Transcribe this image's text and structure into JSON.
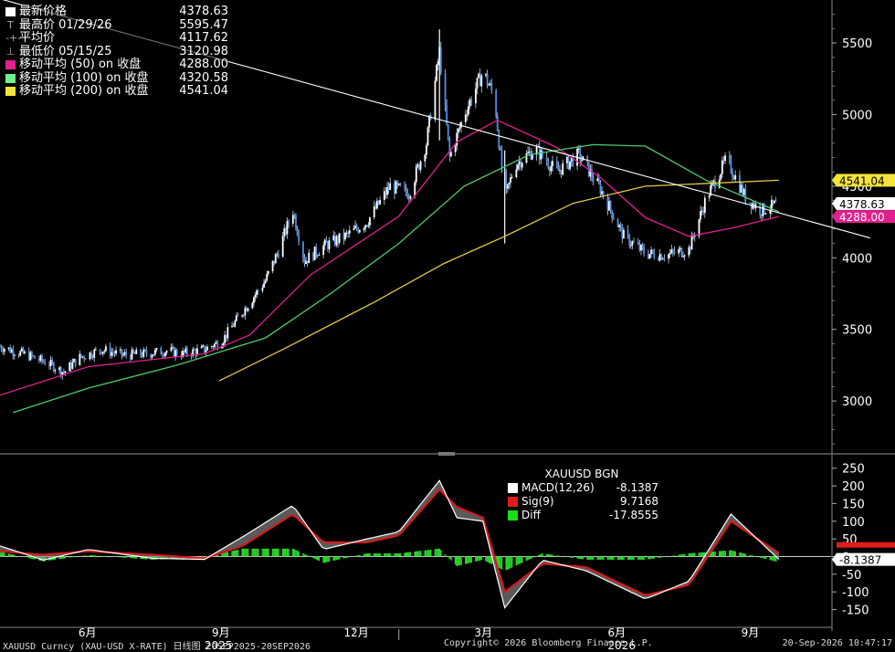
{
  "chart_data": [
    {
      "type": "candlestick",
      "instrument": "XAUUSD Curncy (XAU-USD X-RATE)",
      "ylim": [
        2650,
        5800
      ],
      "y_ticks": [
        3000,
        3500,
        4000,
        4500,
        5000,
        5500
      ],
      "x_ticks": [
        "6月",
        "9月",
        "12月",
        "3月",
        "6月",
        "9月"
      ],
      "year_labels": [
        "2025",
        "2026"
      ],
      "trendline": {
        "from": [
          "2025-09-20",
          6100
        ],
        "to": [
          "2026-09-20",
          4330
        ]
      },
      "close_series": [
        [
          "2025-04-01",
          3380
        ],
        [
          "2025-04-20",
          3320
        ],
        [
          "2025-05-05",
          3260
        ],
        [
          "2025-05-15",
          3200
        ],
        [
          "2025-05-25",
          3300
        ],
        [
          "2025-06-10",
          3360
        ],
        [
          "2025-06-25",
          3320
        ],
        [
          "2025-07-10",
          3330
        ],
        [
          "2025-07-25",
          3350
        ],
        [
          "2025-08-05",
          3330
        ],
        [
          "2025-08-20",
          3360
        ],
        [
          "2025-09-01",
          3420
        ],
        [
          "2025-09-15",
          3620
        ],
        [
          "2025-10-01",
          3840
        ],
        [
          "2025-10-10",
          4050
        ],
        [
          "2025-10-20",
          4330
        ],
        [
          "2025-10-28",
          3980
        ],
        [
          "2025-11-10",
          4080
        ],
        [
          "2025-11-25",
          4150
        ],
        [
          "2025-12-10",
          4250
        ],
        [
          "2025-12-26",
          4500
        ],
        [
          "2026-01-08",
          4450
        ],
        [
          "2026-01-20",
          4800
        ],
        [
          "2026-01-29",
          5440
        ],
        [
          "2026-02-05",
          4700
        ],
        [
          "2026-02-15",
          5000
        ],
        [
          "2026-02-28",
          5300
        ],
        [
          "2026-03-08",
          5120
        ],
        [
          "2026-03-15",
          4400
        ],
        [
          "2026-03-22",
          4650
        ],
        [
          "2026-04-05",
          4760
        ],
        [
          "2026-04-20",
          4600
        ],
        [
          "2026-05-05",
          4720
        ],
        [
          "2026-05-20",
          4480
        ],
        [
          "2026-06-05",
          4150
        ],
        [
          "2026-06-20",
          4030
        ],
        [
          "2026-07-05",
          4020
        ],
        [
          "2026-07-20",
          4060
        ],
        [
          "2026-08-01",
          4420
        ],
        [
          "2026-08-15",
          4690
        ],
        [
          "2026-08-28",
          4420
        ],
        [
          "2026-09-08",
          4330
        ],
        [
          "2026-09-20",
          4378.63
        ]
      ],
      "moving_averages": [
        {
          "name": "移动平均 (50) on 收盘",
          "color": "#e0208e",
          "points": [
            [
              "2025-04-01",
              3040
            ],
            [
              "2025-06-01",
              3240
            ],
            [
              "2025-08-20",
              3330
            ],
            [
              "2025-09-20",
              3460
            ],
            [
              "2025-11-01",
              3880
            ],
            [
              "2026-01-01",
              4290
            ],
            [
              "2026-02-10",
              4810
            ],
            [
              "2026-03-10",
              4960
            ],
            [
              "2026-04-20",
              4770
            ],
            [
              "2026-05-20",
              4560
            ],
            [
              "2026-06-20",
              4280
            ],
            [
              "2026-07-20",
              4150
            ],
            [
              "2026-08-20",
              4210
            ],
            [
              "2026-09-20",
              4288.0
            ]
          ]
        },
        {
          "name": "移动平均 (100) on 收盘",
          "color": "#4fc86c",
          "points": [
            [
              "2025-04-10",
              2920
            ],
            [
              "2025-06-01",
              3090
            ],
            [
              "2025-08-01",
              3250
            ],
            [
              "2025-10-01",
              3440
            ],
            [
              "2025-11-15",
              3750
            ],
            [
              "2026-01-01",
              4100
            ],
            [
              "2026-02-15",
              4500
            ],
            [
              "2026-04-01",
              4720
            ],
            [
              "2026-05-15",
              4790
            ],
            [
              "2026-06-20",
              4780
            ],
            [
              "2026-08-01",
              4540
            ],
            [
              "2026-09-20",
              4320.58
            ]
          ]
        },
        {
          "name": "移动平均 (200) on 收盘",
          "color": "#e3cb47",
          "points": [
            [
              "2025-08-30",
              3140
            ],
            [
              "2025-10-15",
              3370
            ],
            [
              "2025-12-15",
              3690
            ],
            [
              "2026-02-01",
              3960
            ],
            [
              "2026-03-15",
              4150
            ],
            [
              "2026-05-01",
              4380
            ],
            [
              "2026-06-20",
              4500
            ],
            [
              "2026-09-20",
              4541.04
            ]
          ]
        }
      ],
      "price_tags": [
        {
          "value": "4541.04",
          "bg": "#f3e33a",
          "fg": "#000",
          "y": 4541.04
        },
        {
          "value": "4378.63",
          "bg": "#ffffff",
          "fg": "#000",
          "y": 4378.63
        },
        {
          "value": "4288.00",
          "bg": "#e0208e",
          "fg": "#fff",
          "y": 4288.0
        }
      ]
    },
    {
      "type": "macd",
      "ylim": [
        -190,
        270
      ],
      "y_ticks": [
        250,
        200,
        150,
        100,
        50,
        0,
        -50,
        -100,
        -150
      ],
      "macd": [
        [
          "2025-04-01",
          30
        ],
        [
          "2025-05-01",
          -10
        ],
        [
          "2025-06-01",
          20
        ],
        [
          "2025-07-15",
          -5
        ],
        [
          "2025-08-20",
          -8
        ],
        [
          "2025-09-15",
          55
        ],
        [
          "2025-10-20",
          145
        ],
        [
          "2025-11-10",
          20
        ],
        [
          "2025-12-10",
          50
        ],
        [
          "2026-01-01",
          70
        ],
        [
          "2026-01-29",
          215
        ],
        [
          "2026-02-10",
          110
        ],
        [
          "2026-02-28",
          100
        ],
        [
          "2026-03-15",
          -145
        ],
        [
          "2026-04-10",
          -10
        ],
        [
          "2026-05-10",
          -40
        ],
        [
          "2026-06-20",
          -120
        ],
        [
          "2026-07-20",
          -70
        ],
        [
          "2026-08-18",
          120
        ],
        [
          "2026-09-20",
          -8.1387
        ]
      ],
      "signal": [
        [
          "2025-04-01",
          15
        ],
        [
          "2025-05-01",
          5
        ],
        [
          "2025-06-01",
          15
        ],
        [
          "2025-07-15",
          5
        ],
        [
          "2025-08-20",
          -5
        ],
        [
          "2025-09-15",
          30
        ],
        [
          "2025-10-20",
          120
        ],
        [
          "2025-11-10",
          40
        ],
        [
          "2025-12-10",
          40
        ],
        [
          "2026-01-01",
          60
        ],
        [
          "2026-01-29",
          190
        ],
        [
          "2026-02-10",
          140
        ],
        [
          "2026-02-28",
          110
        ],
        [
          "2026-03-15",
          -100
        ],
        [
          "2026-04-10",
          -20
        ],
        [
          "2026-05-10",
          -30
        ],
        [
          "2026-06-20",
          -110
        ],
        [
          "2026-07-20",
          -80
        ],
        [
          "2026-08-18",
          100
        ],
        [
          "2026-09-20",
          9.7168
        ]
      ],
      "series_names": [
        "MACD(12,26)",
        "Sig(9)",
        "Diff"
      ],
      "last_values": [
        "-8.1387",
        "9.7168",
        "-17.8555"
      ],
      "price_tags": [
        {
          "value": "-8.1387",
          "bg": "#ffffff",
          "fg": "#000",
          "y": -8.1387
        }
      ]
    }
  ],
  "legend": {
    "items": [
      {
        "label": "最新价格",
        "value": "4378.63",
        "swatch": "#ffffff",
        "icon": ""
      },
      {
        "label": "最高价 01/29/26",
        "value": "5595.47",
        "swatch": "",
        "icon": "T"
      },
      {
        "label": "平均价",
        "value": "4117.62",
        "swatch": "",
        "icon": "-+-"
      },
      {
        "label": "最低价 05/15/25",
        "value": "3120.98",
        "swatch": "",
        "icon": "⊥"
      },
      {
        "label": "移动平均 (50) on 收盘",
        "value": "4288.00",
        "swatch": "#e0208e",
        "icon": ""
      },
      {
        "label": "移动平均 (100) on 收盘",
        "value": "4320.58",
        "swatch": "#6ff08a",
        "icon": ""
      },
      {
        "label": "移动平均 (200) on 收盘",
        "value": "4541.04",
        "swatch": "#f3e33a",
        "icon": ""
      }
    ]
  },
  "macd_legend": {
    "title": "XAUUSD BGN",
    "rows": [
      {
        "label": "MACD(12,26)",
        "value": "-8.1387",
        "swatch": "#ffffff"
      },
      {
        "label": "Sig(9)",
        "value": "9.7168",
        "swatch": "#e01b1b"
      },
      {
        "label": "Diff",
        "value": "-17.8555",
        "swatch": "#19e019"
      }
    ]
  },
  "footer": {
    "left": "XAUUSD Curncy (XAU-USD X-RATE) 日线图 20SEP2025-20SEP2026",
    "center": "Copyright© 2026 Bloomberg Finance L.P.",
    "right": "20-Sep-2026 10:47:17"
  }
}
